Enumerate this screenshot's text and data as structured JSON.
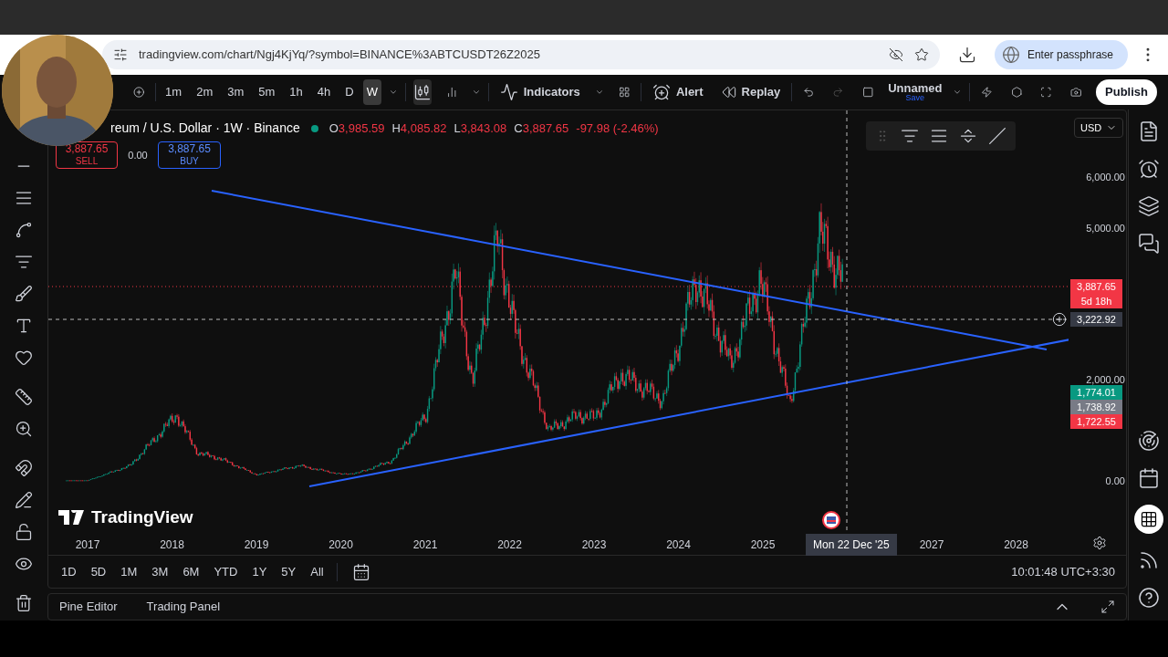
{
  "browser": {
    "url": "tradingview.com/chart/Ngj4KjYq/?symbol=BINANCE%3ABTCUSDT26Z2025",
    "profile": "Enter passphrase"
  },
  "toolbar": {
    "intervals": [
      {
        "label": "1m",
        "selected": false
      },
      {
        "label": "2m",
        "selected": false
      },
      {
        "label": "3m",
        "selected": false
      },
      {
        "label": "5m",
        "selected": false
      },
      {
        "label": "1h",
        "selected": false
      },
      {
        "label": "4h",
        "selected": false
      },
      {
        "label": "D",
        "selected": false
      },
      {
        "label": "W",
        "selected": true
      }
    ],
    "indicators": "Indicators",
    "alert": "Alert",
    "replay": "Replay",
    "layout_name": "Unnamed",
    "save": "Save",
    "publish": "Publish"
  },
  "legend": {
    "symbol": "reum / U.S. Dollar · 1W · Binance",
    "ohlc": [
      {
        "key": "O",
        "value": "3,985.59"
      },
      {
        "key": "H",
        "value": "4,085.82"
      },
      {
        "key": "L",
        "value": "3,843.08"
      },
      {
        "key": "C",
        "value": "3,887.65"
      }
    ],
    "change": "-97.98 (-2.46%)"
  },
  "trade": {
    "sell_price": "3,887.65",
    "sell": "SELL",
    "spread": "0.00",
    "buy_price": "3,887.65",
    "buy": "BUY"
  },
  "currency": "USD",
  "price_axis": [
    "6,000.00",
    "5,000.00",
    "2,000.00",
    "0.00"
  ],
  "price_badges": [
    {
      "kind": "last",
      "value": "3,887.65",
      "sub": "5d 18h",
      "color": "#f23645"
    },
    {
      "kind": "crosshair",
      "value": "3,222.92",
      "color": "#363a45"
    },
    {
      "kind": "level",
      "value": "1,774.01",
      "color": "#089981"
    },
    {
      "kind": "level",
      "value": "1,738.92",
      "color": "#787b86"
    },
    {
      "kind": "level",
      "value": "1,722.55",
      "color": "#f23645"
    }
  ],
  "time_axis": {
    "labels": [
      "2017",
      "2018",
      "2019",
      "2020",
      "2021",
      "2022",
      "2023",
      "2024",
      "2025",
      "2027",
      "2028"
    ],
    "crosshair": "Mon 22 Dec '25"
  },
  "logo": "TradingView",
  "ranges": [
    "1D",
    "5D",
    "1M",
    "3M",
    "6M",
    "YTD",
    "1Y",
    "5Y",
    "All"
  ],
  "clock": "10:01:48 UTC+3:30",
  "bottom_tabs": [
    "Pine Editor",
    "Trading Panel"
  ]
}
